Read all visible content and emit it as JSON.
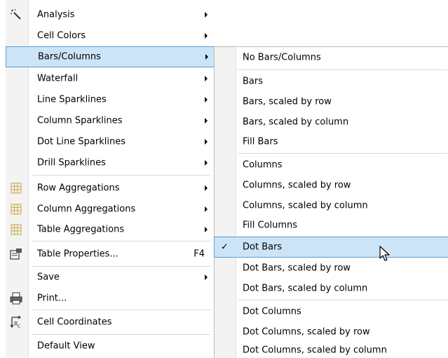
{
  "main_menu": {
    "items": [
      {
        "label": "Analysis",
        "submenu": true
      },
      {
        "label": "Cell Colors",
        "submenu": true
      },
      {
        "label": "Bars/Columns",
        "submenu": true,
        "highlighted": true
      },
      {
        "label": "Waterfall",
        "submenu": true
      },
      {
        "label": "Line Sparklines",
        "submenu": true
      },
      {
        "label": "Column Sparklines",
        "submenu": true
      },
      {
        "label": "Dot Line Sparklines",
        "submenu": true
      },
      {
        "label": "Drill Sparklines",
        "submenu": true
      },
      {
        "label": "Row Aggregations",
        "submenu": true,
        "icon": "grid-icon"
      },
      {
        "label": "Column Aggregations",
        "submenu": true,
        "icon": "grid-icon"
      },
      {
        "label": "Table Aggregations",
        "submenu": true,
        "icon": "grid-icon"
      },
      {
        "label": "Table Properties...",
        "shortcut": "F4",
        "icon": "properties-icon"
      },
      {
        "label": "Save",
        "submenu": true
      },
      {
        "label": "Print...",
        "icon": "printer-icon"
      },
      {
        "label": "Cell Coordinates",
        "icon": "coordinates-icon"
      },
      {
        "label": "Default View"
      }
    ]
  },
  "sub_menu": {
    "items": [
      {
        "label": "No Bars/Columns"
      },
      {
        "label": "Bars"
      },
      {
        "label": "Bars, scaled by row"
      },
      {
        "label": "Bars, scaled by column"
      },
      {
        "label": "Fill Bars"
      },
      {
        "label": "Columns"
      },
      {
        "label": "Columns, scaled by row"
      },
      {
        "label": "Columns, scaled by column"
      },
      {
        "label": "Fill Columns"
      },
      {
        "label": "Dot Bars",
        "checked": true,
        "highlighted": true
      },
      {
        "label": "Dot Bars, scaled by row"
      },
      {
        "label": "Dot Bars, scaled by column"
      },
      {
        "label": "Dot Columns"
      },
      {
        "label": "Dot Columns, scaled by row"
      },
      {
        "label": "Dot Columns, scaled by column"
      }
    ],
    "check_mark": "✓"
  },
  "colors": {
    "highlight_bg": "#cce4f7",
    "highlight_border": "#5b9bd5",
    "gutter": "#f3f3f3",
    "grid_icon": "#c9b458"
  }
}
